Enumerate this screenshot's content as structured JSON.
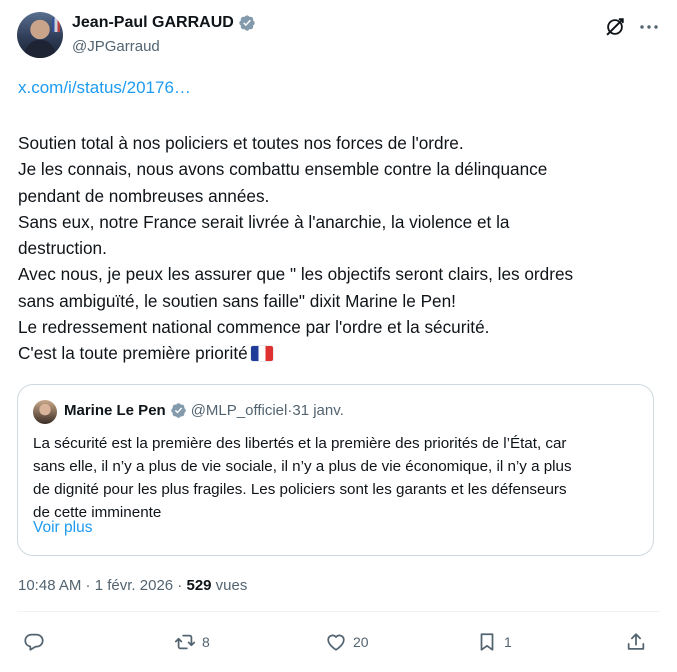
{
  "author": {
    "display_name": "Jean-Paul GARRAUD",
    "handle": "@JPGarraud"
  },
  "link_text": "x.com/i/status/20176…",
  "body_lines": [
    "Soutien total à nos policiers et toutes nos forces de l'ordre.",
    "Je les connais, nous avons combattu ensemble contre la délinquance",
    "pendant de nombreuses années.",
    "Sans eux, notre France serait livrée à l'anarchie, la violence et la",
    "destruction.",
    "Avec nous, je peux les assurer que \" les objectifs seront clairs, les ordres",
    "sans ambiguïté, le soutien sans faille\" dixit Marine le Pen!",
    "Le redressement national commence par l'ordre et la sécurité.",
    "C'est la toute première priorité"
  ],
  "quoted": {
    "display_name": "Marine Le Pen",
    "handle": "@MLP_officiel",
    "separator": " · ",
    "date": "31 janv.",
    "text_lines": [
      "La sécurité est la première des libertés et la première des priorités de l’État, car",
      "sans elle, il n’y a plus de vie sociale, il n’y a plus de vie économique, il n’y a plus",
      "de dignité pour les plus fragiles. Les policiers sont les garants et les défenseurs",
      "de cette imminente"
    ],
    "show_more": "Voir plus"
  },
  "meta": {
    "time": "10:48 AM",
    "date": "1 févr. 2026",
    "separator": " · ",
    "views_count": "529",
    "views_label": " vues"
  },
  "actions": {
    "replies": "",
    "reposts": "8",
    "likes": "20",
    "bookmarks": "1"
  },
  "colors": {
    "accent": "#1d9bf0",
    "verified": "#829aab",
    "text": "#0f1419",
    "secondary": "#536471",
    "border": "#cfd9de"
  },
  "icons": [
    "verified-badge-icon",
    "grok-icon",
    "more-icon",
    "reply-icon",
    "repost-icon",
    "like-icon",
    "bookmark-icon",
    "share-icon",
    "flag-fr-emoji"
  ]
}
